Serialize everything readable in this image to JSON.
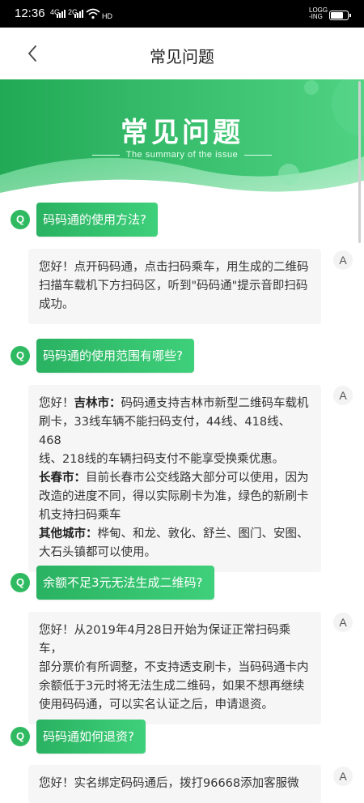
{
  "status_bar": {
    "time": "12:36",
    "network_1": "4G",
    "network_2": "2G",
    "hd": "HD",
    "logging_line1": "LOGG",
    "logging_line2": "-ING",
    "battery_level": 0.85
  },
  "header": {
    "title": "常见问题",
    "back_icon": "chevron-left-icon"
  },
  "banner": {
    "title": "常见问题",
    "subtitle": "The summary of the issue",
    "colors": {
      "green_dark": "#22a956",
      "green_light": "#5fd98b",
      "white": "#ffffff"
    }
  },
  "faq": {
    "q_label": "Q",
    "a_label": "A",
    "items": [
      {
        "question": "码码通的使用方法?",
        "answer_lines": [
          "您好！点开码码通，点击扫码乘车，用生成的二维码",
          "扫描车载机下方扫码区，听到\"码码通\"提示音即扫码",
          "成功。"
        ]
      },
      {
        "question": "码码通的使用范围有哪些?",
        "answer_prefix": "您好！",
        "answer_city1_label": "吉林市：",
        "answer_city1_line1": "码码通支持吉林市新型二维码车载机",
        "answer_city1_line2": "刷卡，33线车辆不能扫码支付，44线、418线、468",
        "answer_city1_line3": "线、218线的车辆扫码支付不能享受换乘优惠。",
        "answer_city2_label": "长春市：",
        "answer_city2_line1": "目前长春市公交线路大部分可以使用，因为",
        "answer_city2_line2": "改造的进度不同，得以实际刷卡为准，绿色的新刷卡",
        "answer_city2_line3": "机支持扫码乘车",
        "answer_city3_label": "其他城市：",
        "answer_city3_line1": "桦甸、和龙、敦化、舒兰、图门、安图、",
        "answer_city3_line2": "大石头镇都可以使用。"
      },
      {
        "question": "余额不足3元无法生成二维码?",
        "answer_lines": [
          "您好！从2019年4月28日开始为保证正常扫码乘车，",
          "部分票价有所调整，不支持透支刷卡，当码码通卡内",
          "余额低于3元时将无法生成二维码，如果不想再继续",
          "使用码码通，可以实名认证之后，申请退资。"
        ]
      },
      {
        "question": "码码通如何退资?",
        "answer_lines": [
          "您好！实名绑定码码通后，拨打96668添加客服微"
        ]
      }
    ]
  }
}
